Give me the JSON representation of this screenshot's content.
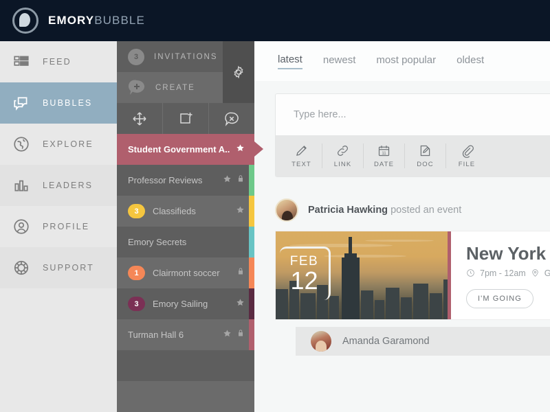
{
  "header": {
    "logo_icon": "bubble-logo-icon",
    "brand_bold": "EMORY",
    "brand_light": "BUBBLE"
  },
  "sidebar": {
    "items": [
      {
        "label": "FEED",
        "icon": "feed-icon",
        "active": false
      },
      {
        "label": "BUBBLES",
        "icon": "bubbles-icon",
        "active": true
      },
      {
        "label": "EXPLORE",
        "icon": "globe-icon",
        "active": false
      },
      {
        "label": "LEADERS",
        "icon": "chart-icon",
        "active": false
      },
      {
        "label": "PROFILE",
        "icon": "person-icon",
        "active": false
      },
      {
        "label": "SUPPORT",
        "icon": "lifebuoy-icon",
        "active": false
      }
    ]
  },
  "bubble_panel": {
    "invitations": {
      "label": "INVITATIONS",
      "count": "3",
      "icon": "count-badge"
    },
    "create": {
      "label": "CREATE",
      "icon": "add-bubble-icon"
    },
    "settings_icon": "gear-icon",
    "tools": [
      {
        "icon": "move-icon",
        "name": "move-bubble"
      },
      {
        "icon": "add-square-icon",
        "name": "add-bubble"
      },
      {
        "icon": "remove-bubble-icon",
        "name": "remove-bubble"
      }
    ],
    "bubbles": [
      {
        "name": "Student Government A..",
        "count": "",
        "badge_color": "",
        "star": true,
        "lock": false,
        "strip": "",
        "active": true
      },
      {
        "name": "Professor Reviews",
        "count": "",
        "badge_color": "",
        "star": true,
        "lock": true,
        "strip": "#6ec98a",
        "active": false
      },
      {
        "name": "Classifieds",
        "count": "3",
        "badge_color": "#f5c63f",
        "star": true,
        "lock": false,
        "strip": "#f5c63f",
        "active": false
      },
      {
        "name": "Emory Secrets",
        "count": "",
        "badge_color": "",
        "star": false,
        "lock": false,
        "strip": "#68c4c4",
        "active": false
      },
      {
        "name": "Clairmont soccer",
        "count": "1",
        "badge_color": "#f58757",
        "star": false,
        "lock": true,
        "strip": "#f58757",
        "active": false
      },
      {
        "name": "Emory Sailing",
        "count": "3",
        "badge_color": "#7b3055",
        "star": true,
        "lock": false,
        "strip": "#5a2b42",
        "active": false
      },
      {
        "name": "Turman Hall 6",
        "count": "",
        "badge_color": "",
        "star": true,
        "lock": true,
        "strip": "#b05f6d",
        "active": false
      },
      {
        "name": "",
        "count": "",
        "badge_color": "",
        "star": false,
        "lock": false,
        "strip": "",
        "active": false
      },
      {
        "name": "",
        "count": "",
        "badge_color": "",
        "star": false,
        "lock": false,
        "strip": "",
        "active": false
      }
    ]
  },
  "main": {
    "tabs": [
      {
        "label": "latest",
        "active": true
      },
      {
        "label": "newest",
        "active": false
      },
      {
        "label": "most popular",
        "active": false
      },
      {
        "label": "oldest",
        "active": false
      }
    ],
    "composer": {
      "placeholder": "Type here...",
      "tools": [
        {
          "label": "TEXT",
          "icon": "pencil-icon"
        },
        {
          "label": "LINK",
          "icon": "link-icon"
        },
        {
          "label": "DATE",
          "icon": "calendar-icon",
          "day": "11"
        },
        {
          "label": "DOC",
          "icon": "doc-edit-icon"
        },
        {
          "label": "FILE",
          "icon": "paperclip-icon"
        }
      ]
    },
    "post": {
      "author": "Patricia Hawking",
      "action": "posted an event",
      "avatar_icon": "avatar",
      "event": {
        "month": "FEB",
        "day": "12",
        "title": "New York",
        "time": "7pm - 12am",
        "time_icon": "clock-icon",
        "location_icon": "location-pin-icon",
        "location": "G",
        "rsvp_label": "I'M GOING"
      },
      "comment": {
        "author": "Amanda Garamond",
        "avatar_icon": "avatar"
      }
    }
  },
  "colors": {
    "topbar": "#0b1626",
    "nav_active": "#91aec0",
    "bubble_active": "#b05f6d",
    "panel": "#5e5e5e"
  }
}
